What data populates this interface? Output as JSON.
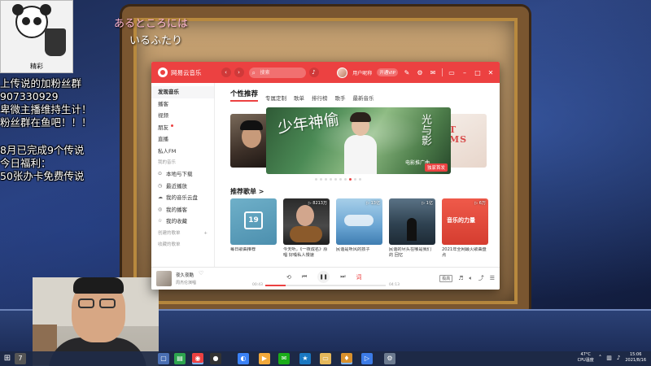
{
  "overlay": {
    "meme_caption": "精彩",
    "jp_line1": "あるところには",
    "jp_line2": "いるふたり",
    "lines": [
      "上传说的加粉丝群",
      "907330929",
      "卑微主播维持生计！",
      "粉丝群在鱼吧！！！",
      "8月已完成9个传说",
      "今日福利：",
      "50张办卡免费传说"
    ]
  },
  "app": {
    "name": "网易云音乐",
    "search_placeholder": "搜索",
    "user_name": "用户昵称",
    "vip_label": "开通VIP",
    "accent": "#ec4141"
  },
  "sidebar": {
    "items": [
      {
        "label": "发现音乐",
        "active": true
      },
      {
        "label": "播客"
      },
      {
        "label": "视频"
      },
      {
        "label": "朋友"
      },
      {
        "label": "直播"
      },
      {
        "label": "私人FM"
      }
    ],
    "my_music_header": "我的音乐",
    "my_music": [
      {
        "icon": "download-icon",
        "glyph": "⊙",
        "label": "本地与下载"
      },
      {
        "icon": "recent-icon",
        "glyph": "◷",
        "label": "最近播放"
      },
      {
        "icon": "cloud-icon",
        "glyph": "☁",
        "label": "我的音乐云盘"
      },
      {
        "icon": "podcast-icon",
        "glyph": "◎",
        "label": "我的播客"
      },
      {
        "icon": "collect-icon",
        "glyph": "☆",
        "label": "我的收藏"
      }
    ],
    "created_header": "创建的歌单",
    "collected_header": "收藏的歌单",
    "plus": "+"
  },
  "tabs": [
    {
      "label": "个性推荐",
      "active": true
    },
    {
      "label": "专属定制"
    },
    {
      "label": "歌单"
    },
    {
      "label": "排行榜"
    },
    {
      "label": "歌手"
    },
    {
      "label": "最新音乐"
    }
  ],
  "banner": {
    "calligraphy": "少年神偷",
    "calligraphy2": "光与影",
    "subtitle": "电影推广曲",
    "badge": "独家首发",
    "right_text": "T\nMS",
    "dot_count": 10,
    "active_dot": 7
  },
  "recommended": {
    "title": "推荐歌单 >",
    "playlists": [
      {
        "name": "每日歌曲推荐",
        "count": "",
        "cover_text": "19"
      },
      {
        "name": "今天听，《一夜成名》原唱 好嗓私人慢速",
        "count": "▷ 8213万",
        "cover_text": ""
      },
      {
        "name": "民谣是听风的孩子",
        "count": "▷ 13亿",
        "cover_text": ""
      },
      {
        "name": "民谣的尽头在哪是我们的 回忆",
        "count": "▷ 1亿",
        "cover_text": ""
      },
      {
        "name": "2021年全网最火歌曲盘点",
        "count": "▷ 6万",
        "cover_text": "音乐的力量"
      }
    ]
  },
  "player": {
    "song": "夜久夜酷",
    "artist": "周杰伦演唱",
    "current_time": "00:43",
    "total_time": "04:13",
    "progress": 0.17,
    "quality": "极高",
    "play_glyph": "❚❚",
    "prev_glyph": "⏮",
    "next_glyph": "⏭",
    "mode_glyph": "⟲",
    "lyric_glyph": "词"
  },
  "taskbar": {
    "badge": "7",
    "temp": "47°C",
    "cpu": "CPU温度",
    "time": "15:06",
    "date": "2021/8/16"
  }
}
